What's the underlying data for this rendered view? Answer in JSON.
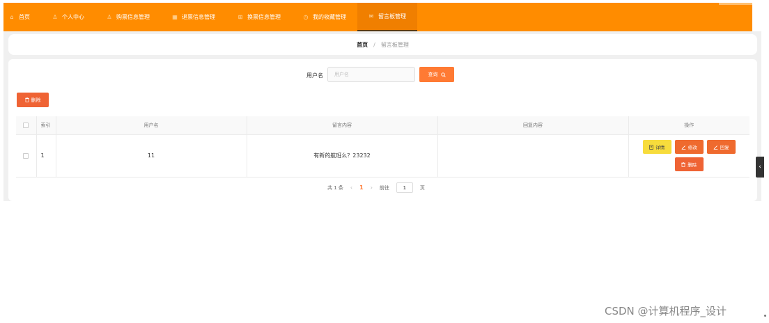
{
  "nav": {
    "items": [
      {
        "label": "首页",
        "icon": "home-icon",
        "glyph": "⌂"
      },
      {
        "label": "个人中心",
        "icon": "user-icon",
        "glyph": "♙"
      },
      {
        "label": "购票信息管理",
        "icon": "user-icon",
        "glyph": "♙"
      },
      {
        "label": "退票信息管理",
        "icon": "grid-icon",
        "glyph": "▦"
      },
      {
        "label": "换票信息管理",
        "icon": "apps-icon",
        "glyph": "⊞"
      },
      {
        "label": "我的收藏管理",
        "icon": "clock-icon",
        "glyph": "◷"
      },
      {
        "label": "留言板管理",
        "icon": "message-icon",
        "glyph": "✉"
      }
    ],
    "active_index": 6
  },
  "breadcrumb": {
    "home": "首页",
    "separator": "/",
    "current": "留言板管理"
  },
  "search": {
    "label": "用户名",
    "placeholder": "用户名",
    "value": "",
    "button": "查询"
  },
  "toolbar": {
    "delete_label": "删除"
  },
  "table": {
    "columns": [
      "索引",
      "用户名",
      "留言内容",
      "回复内容",
      "操作"
    ],
    "rows": [
      {
        "index": "1",
        "username": "11",
        "content": "有新的航班么？23232",
        "reply": ""
      }
    ],
    "actions": {
      "detail": "详情",
      "edit": "修改",
      "reply": "回复",
      "delete": "删除"
    }
  },
  "pagination": {
    "total_text": "共 1 条",
    "prev": "‹",
    "current_page": "1",
    "next": "›",
    "goto_label": "前往",
    "goto_value": "1",
    "page_unit": "页"
  },
  "watermark": "CSDN @计算机程序_设计",
  "colors": {
    "nav_bg": "#ff8c00",
    "primary": "#ff7a33",
    "danger": "#ef6334",
    "warning": "#f7dc3c"
  }
}
